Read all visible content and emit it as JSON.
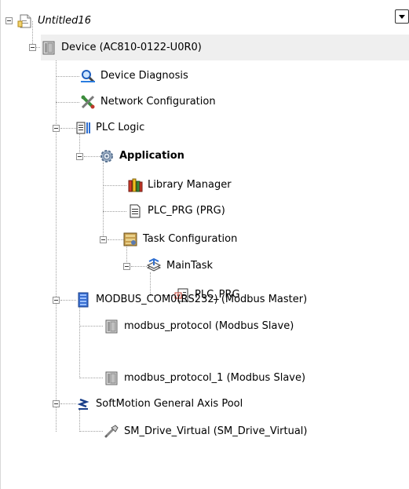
{
  "project": {
    "title": "Untitled16"
  },
  "tree": {
    "device": "Device (AC810-0122-U0R0)",
    "device_diagnosis": "Device Diagnosis",
    "network_configuration": "Network Configuration",
    "plc_logic": "PLC Logic",
    "application": "Application",
    "library_manager": "Library Manager",
    "plc_prg_pou": "PLC_PRG (PRG)",
    "task_configuration": "Task Configuration",
    "main_task": "MainTask",
    "main_task_plc_prg": "PLC_PRG",
    "modbus_com0": "MODBUS_COM0(RS232) (Modbus Master)",
    "modbus_slave_1": "modbus_protocol (Modbus Slave)",
    "modbus_slave_2": "modbus_protocol_1 (Modbus Slave)",
    "softmotion_pool": "SoftMotion General Axis Pool",
    "sm_drive_virtual": "SM_Drive_Virtual (SM_Drive_Virtual)"
  },
  "icons": {
    "project": "project-file-icon",
    "device": "device-icon",
    "diagnosis": "magnifier-icon",
    "network": "network-tools-icon",
    "plc_logic": "plc-logic-icon",
    "application": "gear-icon",
    "library": "books-icon",
    "pou": "document-icon",
    "task_config": "task-configuration-icon",
    "task": "task-stack-icon",
    "program_call": "program-call-icon",
    "modbus_master": "modbus-master-icon",
    "modbus_slave": "slave-device-icon",
    "axis_pool": "axis-pool-icon",
    "drive": "virtual-drive-icon"
  }
}
